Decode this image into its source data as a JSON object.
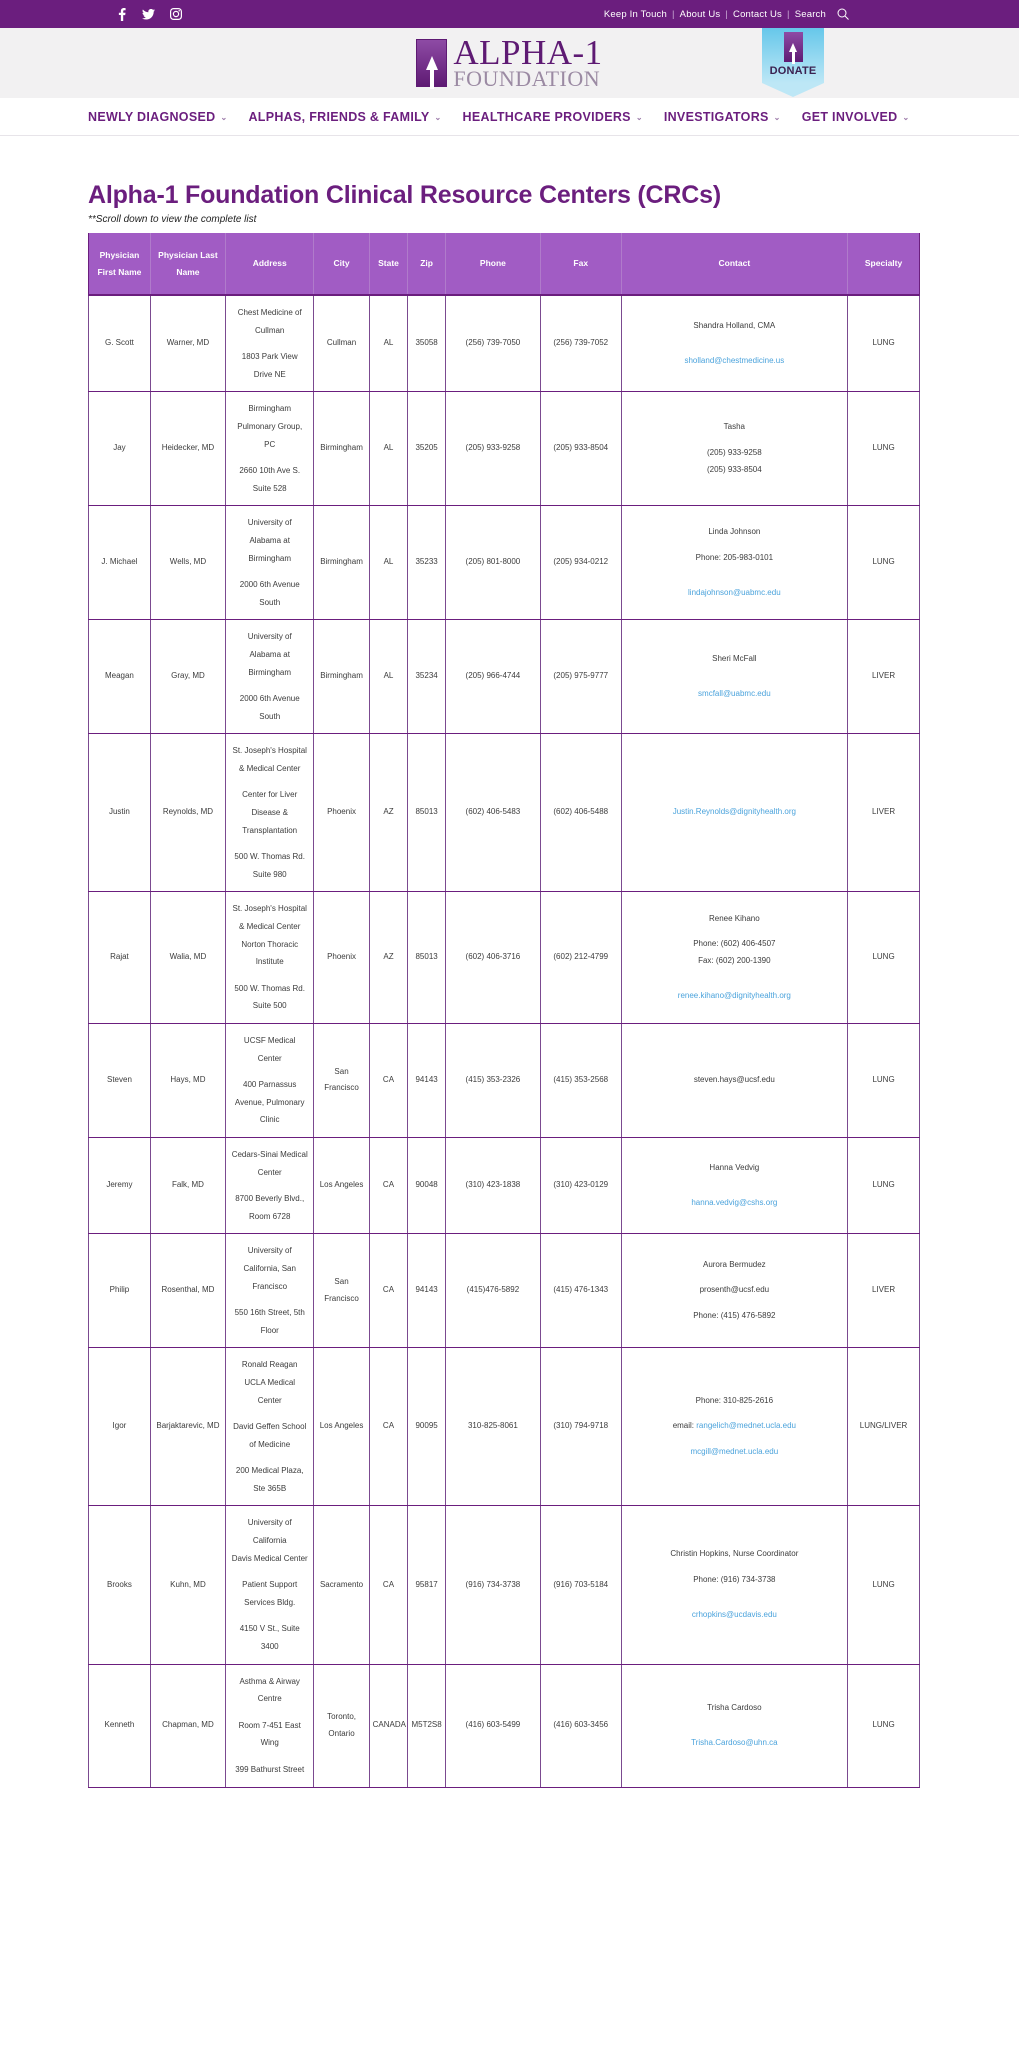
{
  "topbar": {
    "social": [
      {
        "name": "facebook-icon",
        "glyph": "f"
      },
      {
        "name": "twitter-icon",
        "glyph": "t"
      },
      {
        "name": "instagram-icon",
        "glyph": "i"
      }
    ],
    "links": [
      "Keep In Touch",
      "About Us",
      "Contact Us",
      "Search"
    ],
    "separator": "|"
  },
  "brand": {
    "line1": "ALPHA-1",
    "line2": "FOUNDATION"
  },
  "donate": {
    "label": "DONATE"
  },
  "nav": {
    "items": [
      {
        "label": "NEWLY DIAGNOSED",
        "caret": "⌄"
      },
      {
        "label": "ALPHAS, FRIENDS & FAMILY",
        "caret": "⌄"
      },
      {
        "label": "HEALTHCARE PROVIDERS",
        "caret": "⌄"
      },
      {
        "label": "INVESTIGATORS",
        "caret": "⌄"
      },
      {
        "label": "GET INVOLVED",
        "caret": "⌄"
      }
    ]
  },
  "page": {
    "title": "Alpha-1 Foundation Clinical Resource Centers (CRCs)",
    "subtitle": "**Scroll down to view the complete list"
  },
  "table": {
    "headers": [
      "Physician First Name",
      "Physician Last Name",
      "Address",
      "City",
      "State",
      "Zip",
      "Phone",
      "Fax",
      "Contact",
      "Specialty"
    ],
    "header_colors": {
      "background": "#A15CC4",
      "text": "#FFFFFF",
      "border": "#6B1E7E"
    },
    "link_color": "#4BA3DC",
    "rows": [
      {
        "first_name": "G. Scott",
        "last_name": "Warner, MD",
        "address": [
          "Chest Medicine of",
          "Cullman",
          "",
          "1803 Park View",
          "Drive NE"
        ],
        "city": "Cullman",
        "state": "AL",
        "zip": "35058",
        "phone": "(256) 739-7050",
        "fax": "(256) 739-7052",
        "contact_lines": [
          "Shandra Holland, CMA",
          ""
        ],
        "contact_email": "sholland@chestmedicine.us",
        "specialty": "LUNG"
      },
      {
        "first_name": "Jay",
        "last_name": "Heidecker, MD",
        "address": [
          "Birmingham",
          "Pulmonary Group,",
          "PC",
          "",
          "2660 10th Ave S.",
          "Suite 528"
        ],
        "city": "Birmingham",
        "state": "AL",
        "zip": "35205",
        "phone": "(205) 933-9258",
        "fax": "(205) 933-8504",
        "contact_lines": [
          "Tasha",
          "",
          "(205) 933-9258",
          "(205) 933-8504"
        ],
        "contact_email": "",
        "specialty": "LUNG",
        "overlay": {
          "first_name": "Jay",
          "last_name": "Heidecker, MD",
          "address_line": "Pulmonary Group,",
          "city": "Birmingham",
          "state": "AL",
          "zip": "35205",
          "phone": "(205) 933-9258",
          "fax": "(205) 933-8504",
          "contact": "Tasha",
          "specialty": "LUNG"
        }
      },
      {
        "first_name": "J. Michael",
        "last_name": "Wells, MD",
        "address": [
          "University of",
          "Alabama at",
          "Birmingham",
          "",
          "2000 6th Avenue",
          "South"
        ],
        "city": "Birmingham",
        "state": "AL",
        "zip": "35233",
        "phone": "(205) 801-8000",
        "fax": "(205) 934-0212",
        "contact_lines": [
          "Linda Johnson",
          "",
          "Phone: 205-983-0101",
          ""
        ],
        "contact_email": "lindajohnson@uabmc.edu",
        "specialty": "LUNG"
      },
      {
        "first_name": "Meagan",
        "last_name": "Gray, MD",
        "address": [
          "University of",
          "Alabama at",
          "Birmingham",
          "",
          "2000 6th Avenue",
          "South"
        ],
        "city": "Birmingham",
        "state": "AL",
        "zip": "35234",
        "phone": "(205) 966-4744",
        "fax": "(205) 975-9777",
        "contact_lines": [
          "Sheri McFall",
          ""
        ],
        "contact_email": "smcfall@uabmc.edu",
        "specialty": "LIVER"
      },
      {
        "first_name": "Justin",
        "last_name": "Reynolds, MD",
        "address": [
          "St. Joseph's Hospital",
          "& Medical Center",
          "",
          "Center for Liver",
          "Disease &",
          "Transplantation",
          "",
          "500 W. Thomas Rd.",
          "Suite 980"
        ],
        "city": "Phoenix",
        "state": "AZ",
        "zip": "85013",
        "phone": "(602) 406-5483",
        "fax": "(602) 406-5488",
        "contact_lines": [],
        "contact_email": "Justin.Reynolds@dignityhealth.org",
        "specialty": "LIVER"
      },
      {
        "first_name": "Rajat",
        "last_name": "Walia, MD",
        "address": [
          "St. Joseph's Hospital",
          "& Medical Center",
          "Norton Thoracic",
          "Institute",
          "",
          "500 W. Thomas Rd.",
          "Suite 500"
        ],
        "city": "Phoenix",
        "state": "AZ",
        "zip": "85013",
        "phone": "(602) 406-3716",
        "fax": "(602) 212-4799",
        "contact_lines": [
          "Renee Kihano",
          "",
          "Phone: (602) 406-4507",
          "Fax: (602) 200-1390",
          ""
        ],
        "contact_email": "renee.kihano@dignityhealth.org",
        "specialty": "LUNG"
      },
      {
        "first_name": "Steven",
        "last_name": "Hays, MD",
        "address": [
          "UCSF Medical",
          "Center",
          "",
          "400 Parnassus",
          "Avenue, Pulmonary",
          "Clinic"
        ],
        "city": "San Francisco",
        "state": "CA",
        "zip": "94143",
        "phone": "(415) 353-2326",
        "fax": "(415) 353-2568",
        "contact_lines": [
          "steven.hays@ucsf.edu"
        ],
        "contact_email": "",
        "specialty": "LUNG"
      },
      {
        "first_name": "Jeremy",
        "last_name": "Falk, MD",
        "address": [
          "Cedars-Sinai Medical",
          "Center",
          "",
          "8700 Beverly Blvd.,",
          "Room 6728"
        ],
        "city": "Los Angeles",
        "state": "CA",
        "zip": "90048",
        "phone": "(310) 423-1838",
        "fax": "(310) 423-0129",
        "contact_lines": [
          "Hanna Vedvig",
          ""
        ],
        "contact_email": "hanna.vedvig@cshs.org",
        "specialty": "LUNG"
      },
      {
        "first_name": "Philip",
        "last_name": "Rosenthal, MD",
        "address": [
          "University of",
          "California, San",
          "Francisco",
          "",
          "550 16th Street, 5th",
          "Floor"
        ],
        "city": "San Francisco",
        "state": "CA",
        "zip": "94143",
        "phone": "(415)476-5892",
        "fax": "(415) 476-1343",
        "contact_lines": [
          "Aurora Bermudez",
          "",
          "prosenth@ucsf.edu",
          "",
          "Phone: (415) 476-5892"
        ],
        "contact_email": "",
        "specialty": "LIVER"
      },
      {
        "first_name": "Igor",
        "last_name": "Barjaktarevic, MD",
        "address": [
          "Ronald Reagan",
          "UCLA Medical",
          "Center",
          "",
          "David Geffen School",
          "of Medicine",
          "",
          "200 Medical Plaza,",
          "Ste 365B"
        ],
        "city": "Los Angeles",
        "state": "CA",
        "zip": "90095",
        "phone": "310-825-8061",
        "fax": "(310) 794-9718",
        "contact_lines": [
          "Phone: 310-825-2616"
        ],
        "contact_email_prefix": "email: ",
        "contact_email": "rangelich@mednet.ucla.edu",
        "contact_email2": "mcgill@mednet.ucla.edu",
        "specialty": "LUNG/LIVER"
      },
      {
        "first_name": "Brooks",
        "last_name": "Kuhn, MD",
        "address": [
          "University of",
          "California",
          "Davis Medical Center",
          "",
          "Patient Support",
          "Services Bldg.",
          "",
          "4150 V St., Suite",
          "3400"
        ],
        "city": "Sacramento",
        "state": "CA",
        "zip": "95817",
        "phone": "(916) 734-3738",
        "fax": "(916) 703-5184",
        "contact_lines": [
          "Christin Hopkins, Nurse Coordinator",
          "",
          "Phone: (916) 734-3738",
          ""
        ],
        "contact_email": "crhopkins@ucdavis.edu",
        "specialty": "LUNG"
      },
      {
        "first_name": "Kenneth",
        "last_name": "Chapman, MD",
        "address": [
          "Asthma & Airway",
          "Centre",
          "",
          "Room 7-451 East",
          "Wing",
          "",
          "399 Bathurst Street"
        ],
        "city": "Toronto, Ontario",
        "state": "CANADA",
        "zip": "M5T2S8",
        "phone": "(416) 603-5499",
        "fax": "(416) 603-3456",
        "contact_lines": [
          "Trisha Cardoso",
          ""
        ],
        "contact_email": "Trisha.Cardoso@uhn.ca",
        "specialty": "LUNG"
      }
    ]
  }
}
